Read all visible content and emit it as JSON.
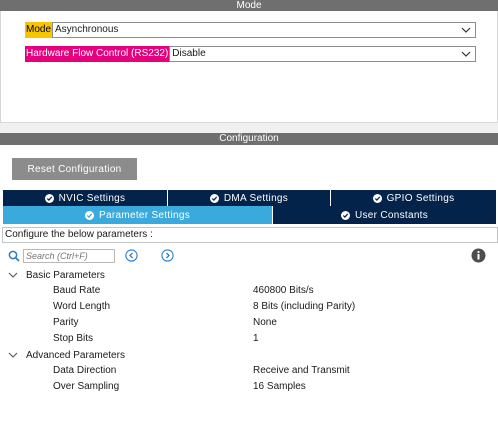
{
  "mode": {
    "header": "Mode",
    "fields": [
      {
        "label": "Mode",
        "value": "Asynchronous",
        "label_color": "#f7c600"
      },
      {
        "label": "Hardware Flow Control (RS232)",
        "value": "Disable",
        "label_color": "#e5007e"
      }
    ]
  },
  "configuration": {
    "header": "Configuration",
    "reset_label": "Reset Configuration",
    "tabs_row1": [
      "NVIC Settings",
      "DMA Settings",
      "GPIO Settings"
    ],
    "tabs_row2": [
      "Parameter Settings",
      "User Constants"
    ],
    "active_tab": "Parameter Settings",
    "caption": "Configure the below parameters :",
    "search_placeholder": "Search (Ctrl+F)",
    "groups": [
      {
        "name": "Basic Parameters",
        "params": [
          {
            "name": "Baud Rate",
            "value": "460800 Bits/s"
          },
          {
            "name": "Word Length",
            "value": "8 Bits (including Parity)"
          },
          {
            "name": "Parity",
            "value": "None"
          },
          {
            "name": "Stop Bits",
            "value": "1"
          }
        ]
      },
      {
        "name": "Advanced Parameters",
        "params": [
          {
            "name": "Data Direction",
            "value": "Receive and Transmit"
          },
          {
            "name": "Over Sampling",
            "value": "16 Samples"
          }
        ]
      }
    ]
  },
  "colors": {
    "header_gray": "#6f6f6f",
    "tab_dark": "#03234b",
    "tab_active": "#3aaadc",
    "accent_blue": "#2d7fc1"
  },
  "icons": [
    "chevron-down-icon",
    "check-circle-icon",
    "search-icon",
    "arrow-left-circle-icon",
    "arrow-right-circle-icon",
    "info-icon",
    "expand-chevron-icon"
  ]
}
